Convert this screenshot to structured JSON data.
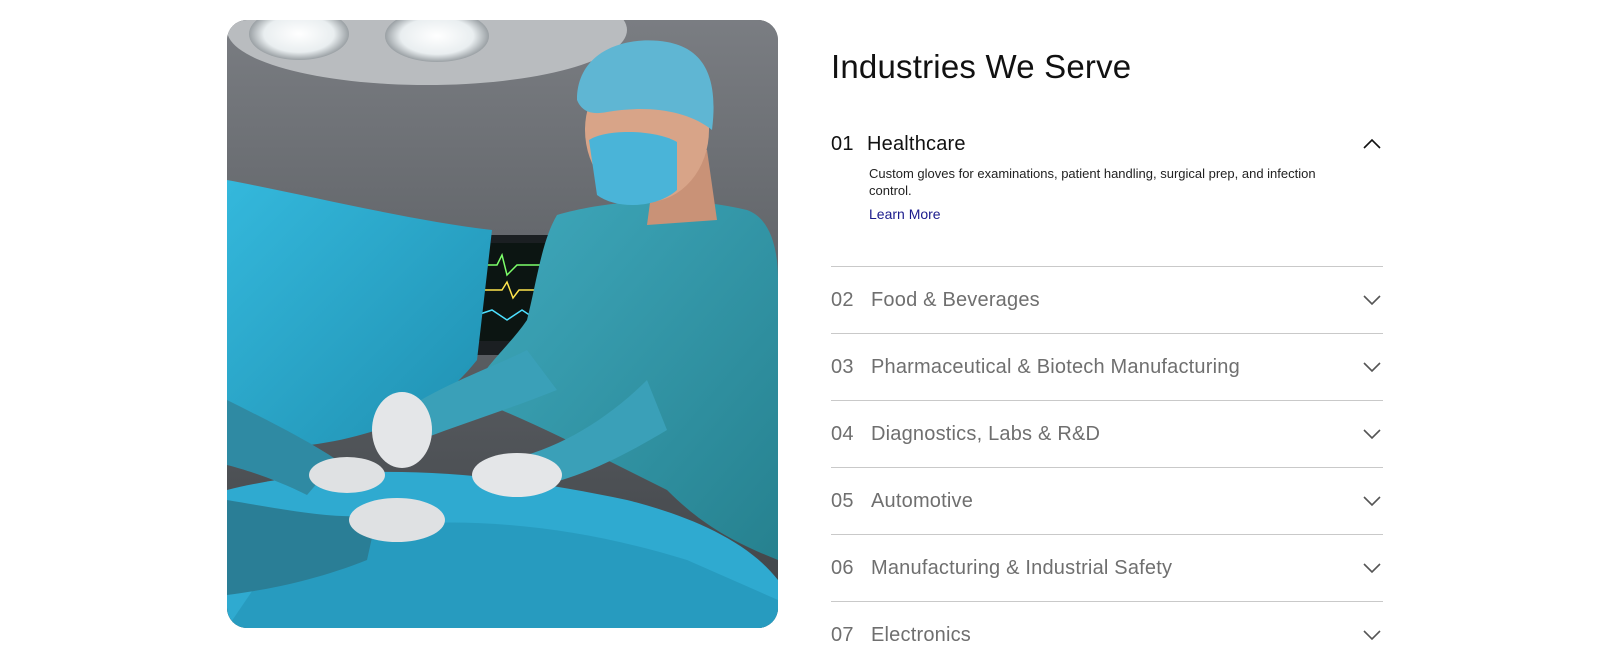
{
  "section": {
    "title": "Industries We Serve"
  },
  "image": {
    "alt_icon": "surgeon-operating-room-photo"
  },
  "accordion": {
    "items": [
      {
        "number": "01",
        "label": "Healthcare",
        "open": true,
        "description": "Custom gloves for examinations, patient handling, surgical prep, and infection control.",
        "link": "Learn More"
      },
      {
        "number": "02",
        "label": "Food & Beverages",
        "open": false
      },
      {
        "number": "03",
        "label": "Pharmaceutical & Biotech Manufacturing",
        "open": false
      },
      {
        "number": "04",
        "label": "Diagnostics, Labs & R&D",
        "open": false
      },
      {
        "number": "05",
        "label": "Automotive",
        "open": false
      },
      {
        "number": "06",
        "label": "Manufacturing & Industrial Safety",
        "open": false
      },
      {
        "number": "07",
        "label": "Electronics",
        "open": false
      }
    ]
  },
  "colors": {
    "title": "#111111",
    "muted_text": "#6f6f6f",
    "link": "#1a1a8c",
    "divider": "#c9c9c9",
    "scrubs_teal": "#2aa3c4"
  }
}
